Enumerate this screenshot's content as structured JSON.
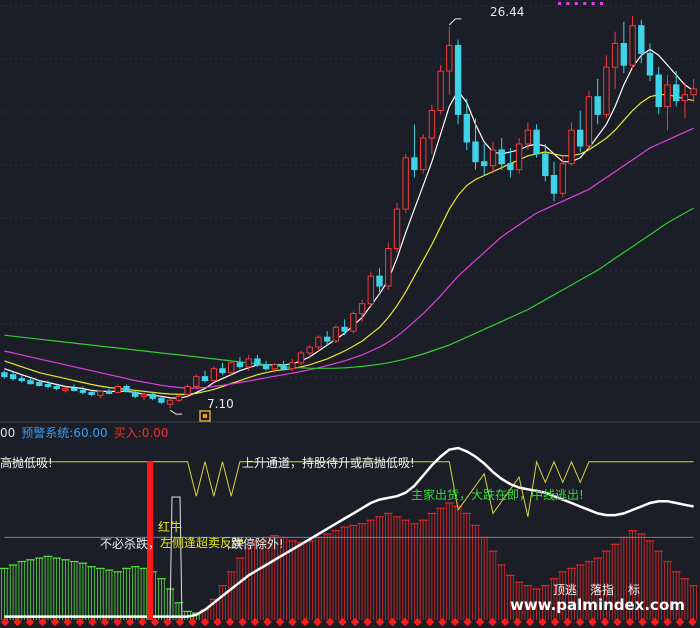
{
  "colors": {
    "background": "#1b1e26",
    "grid": "#2b303c",
    "up": "#f03a3a",
    "down": "#3fd3e8",
    "ma_white": "#ffffff",
    "ma_yellow": "#e8e830",
    "ma_magenta": "#e040e0",
    "ma_green": "#33cc33",
    "pink_dot": "#e040e0",
    "warn_line": "#d4d440",
    "blue_line": "#3c8cd8",
    "green_hist": "#56e03c",
    "red_hist": "#e02424",
    "signal_bar": "#ff1a1a"
  },
  "readout": {
    "value_prefix": "00",
    "warn_label": "预警系统:",
    "warn_value": "60.00",
    "buy_label": "买入:",
    "buy_value": "0.00"
  },
  "annotations": {
    "high_label": "26.44",
    "low_label": "7.10",
    "text_top_left": "高抛低吸!",
    "text_up_channel": "上升通道，持股待升或高抛低吸!",
    "text_main_out": "主家出货，大跌在即，中线逃出!",
    "text_no_sell": "不必杀跌，",
    "text_overlap": "左侧逢超卖反弹",
    "text_limit_down": ",跌停除外!",
    "text_red_cow": "红牛",
    "text_top_escape": "顶逃",
    "text_drop_index": "落指",
    "text_mark": "标",
    "watermark": "www.palmindex.com"
  },
  "chart_data": {
    "type": "candlestick",
    "price": {
      "candles": [
        [
          8.9,
          9.0,
          8.6,
          8.7
        ],
        [
          8.8,
          8.9,
          8.5,
          8.6
        ],
        [
          8.6,
          8.8,
          8.4,
          8.5
        ],
        [
          8.5,
          8.6,
          8.3,
          8.35
        ],
        [
          8.4,
          8.5,
          8.2,
          8.25
        ],
        [
          8.3,
          8.5,
          8.1,
          8.2
        ],
        [
          8.2,
          8.3,
          8.0,
          8.1
        ],
        [
          8.0,
          8.2,
          7.9,
          8.1
        ],
        [
          8.1,
          8.3,
          7.95,
          8.0
        ],
        [
          8.0,
          8.2,
          7.8,
          7.9
        ],
        [
          7.9,
          8.0,
          7.7,
          7.8
        ],
        [
          7.75,
          8.0,
          7.6,
          7.95
        ],
        [
          7.95,
          8.1,
          7.8,
          7.85
        ],
        [
          7.9,
          8.3,
          7.85,
          8.2
        ],
        [
          8.2,
          8.3,
          7.9,
          7.95
        ],
        [
          7.9,
          8.0,
          7.6,
          7.7
        ],
        [
          7.7,
          7.9,
          7.5,
          7.8
        ],
        [
          7.8,
          7.9,
          7.5,
          7.6
        ],
        [
          7.6,
          7.7,
          7.3,
          7.4
        ],
        [
          7.3,
          7.6,
          7.1,
          7.5
        ],
        [
          7.5,
          7.8,
          7.4,
          7.7
        ],
        [
          7.8,
          8.3,
          7.7,
          8.2
        ],
        [
          8.2,
          8.8,
          8.1,
          8.7
        ],
        [
          8.7,
          9.0,
          8.4,
          8.5
        ],
        [
          8.5,
          9.2,
          8.5,
          9.1
        ],
        [
          9.1,
          9.4,
          8.8,
          8.9
        ],
        [
          8.9,
          9.5,
          8.8,
          9.4
        ],
        [
          9.4,
          9.7,
          9.1,
          9.2
        ],
        [
          9.2,
          9.8,
          9.0,
          9.6
        ],
        [
          9.6,
          9.8,
          9.2,
          9.3
        ],
        [
          9.3,
          9.5,
          9.0,
          9.1
        ],
        [
          9.1,
          9.4,
          8.9,
          9.3
        ],
        [
          9.3,
          9.5,
          9.0,
          9.1
        ],
        [
          9.1,
          9.6,
          9.0,
          9.4
        ],
        [
          9.4,
          10.0,
          9.3,
          9.9
        ],
        [
          9.9,
          10.3,
          9.6,
          10.2
        ],
        [
          10.2,
          10.8,
          10.0,
          10.7
        ],
        [
          10.7,
          11.0,
          10.3,
          10.5
        ],
        [
          10.5,
          11.3,
          10.4,
          11.2
        ],
        [
          11.2,
          11.6,
          10.8,
          11.0
        ],
        [
          11.0,
          12.0,
          10.9,
          11.9
        ],
        [
          11.9,
          12.6,
          11.5,
          12.4
        ],
        [
          12.4,
          14.0,
          12.2,
          13.8
        ],
        [
          13.8,
          14.2,
          13.0,
          13.3
        ],
        [
          13.3,
          15.5,
          13.1,
          15.2
        ],
        [
          15.2,
          17.5,
          15.0,
          17.2
        ],
        [
          17.2,
          20.0,
          17.0,
          19.8
        ],
        [
          19.8,
          21.5,
          18.8,
          19.2
        ],
        [
          19.2,
          21.0,
          19.0,
          20.8
        ],
        [
          20.8,
          22.5,
          20.0,
          22.2
        ],
        [
          22.2,
          24.5,
          22.0,
          24.2
        ],
        [
          24.2,
          26.44,
          23.0,
          25.5
        ],
        [
          25.5,
          25.8,
          21.5,
          22.0
        ],
        [
          22.0,
          22.8,
          20.2,
          20.6
        ],
        [
          20.6,
          21.8,
          19.2,
          19.6
        ],
        [
          19.6,
          20.5,
          18.9,
          19.4
        ],
        [
          19.4,
          20.6,
          19.0,
          20.2
        ],
        [
          20.2,
          20.8,
          19.2,
          19.5
        ],
        [
          19.5,
          20.3,
          18.8,
          19.2
        ],
        [
          19.2,
          20.8,
          19.0,
          20.5
        ],
        [
          20.5,
          21.6,
          20.2,
          21.2
        ],
        [
          21.2,
          21.5,
          19.8,
          20.0
        ],
        [
          20.0,
          20.5,
          18.6,
          18.9
        ],
        [
          18.9,
          19.6,
          17.6,
          18.0
        ],
        [
          18.0,
          19.9,
          17.8,
          19.5
        ],
        [
          19.5,
          21.6,
          19.4,
          21.2
        ],
        [
          21.2,
          22.2,
          20.1,
          20.4
        ],
        [
          20.4,
          23.2,
          20.2,
          22.9
        ],
        [
          22.9,
          23.8,
          21.5,
          22.0
        ],
        [
          22.0,
          25.0,
          21.8,
          24.4
        ],
        [
          24.4,
          26.2,
          23.3,
          25.6
        ],
        [
          25.6,
          26.7,
          24.1,
          24.5
        ],
        [
          24.5,
          27.0,
          24.3,
          26.5
        ],
        [
          26.5,
          26.8,
          24.6,
          25.1
        ],
        [
          25.1,
          25.6,
          23.7,
          24.0
        ],
        [
          24.0,
          24.4,
          22.0,
          22.4
        ],
        [
          22.4,
          24.0,
          21.2,
          23.5
        ],
        [
          23.5,
          24.2,
          22.4,
          22.7
        ],
        [
          22.7,
          23.6,
          21.8,
          23.0
        ],
        [
          23.0,
          23.8,
          22.6,
          23.3
        ]
      ],
      "ma": [
        {
          "color": "white",
          "values": [
            9.1,
            8.95,
            8.8,
            8.65,
            8.5,
            8.4,
            8.3,
            8.2,
            8.15,
            8.1,
            8.0,
            7.95,
            7.95,
            7.95,
            7.95,
            7.9,
            7.8,
            7.75,
            7.7,
            7.62,
            7.6,
            7.7,
            7.9,
            8.1,
            8.4,
            8.6,
            8.8,
            9.0,
            9.15,
            9.3,
            9.3,
            9.3,
            9.3,
            9.35,
            9.5,
            9.7,
            10.0,
            10.3,
            10.6,
            10.9,
            11.3,
            11.7,
            12.3,
            12.9,
            13.6,
            14.7,
            16.0,
            17.2,
            18.4,
            19.6,
            21.0,
            22.4,
            23.2,
            22.6,
            21.5,
            20.6,
            20.1,
            20.0,
            20.1,
            20.2,
            20.4,
            20.5,
            20.4,
            20.0,
            19.6,
            19.6,
            19.8,
            20.3,
            20.9,
            21.5,
            22.4,
            23.5,
            24.4,
            25.0,
            25.3,
            25.0,
            24.5,
            24.0,
            23.5,
            23.2
          ]
        },
        {
          "color": "yellow",
          "values": [
            9.5,
            9.35,
            9.2,
            9.05,
            8.9,
            8.8,
            8.7,
            8.6,
            8.5,
            8.4,
            8.3,
            8.22,
            8.15,
            8.1,
            8.05,
            8.0,
            7.95,
            7.9,
            7.85,
            7.82,
            7.8,
            7.8,
            7.85,
            7.95,
            8.05,
            8.2,
            8.35,
            8.5,
            8.65,
            8.8,
            8.9,
            9.0,
            9.05,
            9.1,
            9.2,
            9.3,
            9.45,
            9.6,
            9.8,
            10.0,
            10.25,
            10.5,
            10.85,
            11.2,
            11.7,
            12.3,
            13.0,
            13.8,
            14.6,
            15.4,
            16.3,
            17.2,
            17.9,
            18.4,
            18.7,
            18.9,
            19.1,
            19.3,
            19.5,
            19.7,
            19.9,
            20.0,
            20.1,
            20.0,
            19.9,
            19.9,
            20.0,
            20.2,
            20.5,
            20.8,
            21.2,
            21.7,
            22.2,
            22.6,
            22.9,
            23.0,
            23.0,
            22.9,
            22.8,
            22.7
          ]
        },
        {
          "color": "magenta",
          "values": [
            10.0,
            9.9,
            9.8,
            9.7,
            9.6,
            9.5,
            9.4,
            9.3,
            9.2,
            9.1,
            9.0,
            8.9,
            8.8,
            8.7,
            8.6,
            8.5,
            8.42,
            8.34,
            8.26,
            8.2,
            8.15,
            8.12,
            8.12,
            8.15,
            8.2,
            8.26,
            8.33,
            8.4,
            8.48,
            8.56,
            8.64,
            8.72,
            8.8,
            8.88,
            8.96,
            9.05,
            9.15,
            9.26,
            9.38,
            9.5,
            9.65,
            9.8,
            10.0,
            10.2,
            10.45,
            10.75,
            11.1,
            11.5,
            11.9,
            12.35,
            12.8,
            13.3,
            13.8,
            14.2,
            14.6,
            15.0,
            15.4,
            15.8,
            16.1,
            16.4,
            16.7,
            17.0,
            17.2,
            17.4,
            17.6,
            17.8,
            18.0,
            18.2,
            18.5,
            18.8,
            19.1,
            19.4,
            19.7,
            20.0,
            20.3,
            20.5,
            20.7,
            20.9,
            21.1,
            21.3
          ]
        },
        {
          "color": "green",
          "values": [
            10.8,
            10.75,
            10.7,
            10.65,
            10.6,
            10.55,
            10.5,
            10.45,
            10.4,
            10.35,
            10.3,
            10.25,
            10.2,
            10.15,
            10.1,
            10.05,
            10.0,
            9.95,
            9.9,
            9.85,
            9.8,
            9.75,
            9.7,
            9.65,
            9.6,
            9.55,
            9.5,
            9.45,
            9.4,
            9.35,
            9.3,
            9.25,
            9.2,
            9.17,
            9.15,
            9.13,
            9.12,
            9.12,
            9.13,
            9.15,
            9.18,
            9.22,
            9.27,
            9.33,
            9.4,
            9.5,
            9.6,
            9.72,
            9.85,
            10.0,
            10.15,
            10.3,
            10.5,
            10.7,
            10.9,
            11.1,
            11.3,
            11.5,
            11.7,
            11.9,
            12.1,
            12.35,
            12.6,
            12.85,
            13.1,
            13.35,
            13.6,
            13.85,
            14.1,
            14.4,
            14.7,
            15.0,
            15.3,
            15.6,
            15.9,
            16.2,
            16.5,
            16.75,
            17.0,
            17.25
          ]
        }
      ],
      "high": {
        "value": 26.44,
        "index": 51
      },
      "low": {
        "value": 7.1,
        "index": 19
      },
      "ylim": [
        6.5,
        27.5
      ]
    },
    "indicator": {
      "ylim": [
        0,
        100
      ],
      "white_line": [
        2,
        2,
        2,
        2,
        2,
        2,
        2,
        2,
        2,
        2,
        2,
        2,
        2,
        2,
        2,
        2,
        2,
        2,
        2,
        2,
        2,
        2,
        3,
        6,
        10,
        14,
        18,
        22,
        26,
        29,
        32,
        35,
        38,
        41,
        44,
        47,
        50,
        53,
        56,
        59,
        62,
        65,
        68,
        70,
        71,
        72,
        74,
        78,
        84,
        90,
        95,
        99,
        100,
        98,
        95,
        91,
        86,
        82,
        79,
        77,
        76,
        75,
        74,
        72,
        70,
        68,
        66,
        64,
        62,
        61,
        61,
        62,
        64,
        66,
        68,
        69,
        69,
        68,
        67,
        66
      ],
      "yellow_line": [
        92,
        92,
        92,
        92,
        92,
        92,
        92,
        92,
        92,
        92,
        92,
        92,
        92,
        92,
        92,
        92,
        92,
        92,
        92,
        92,
        92,
        92,
        92,
        92,
        92,
        92,
        92,
        92,
        92,
        92,
        92,
        92,
        92,
        92,
        92,
        92,
        92,
        92,
        92,
        92,
        92,
        92,
        92,
        92,
        92,
        92,
        92,
        92,
        92,
        92,
        92,
        92,
        92,
        92,
        92,
        92,
        92,
        92,
        92,
        92,
        92,
        92,
        92,
        92,
        92,
        92,
        92,
        92,
        92,
        92,
        92,
        92,
        92,
        92,
        92,
        92,
        92,
        92,
        92,
        92
      ],
      "blue_line": [
        48,
        48,
        48,
        48,
        48,
        48,
        48,
        48,
        48,
        48,
        48,
        48,
        48,
        48,
        48,
        48,
        48,
        48,
        48,
        48,
        48,
        48,
        48,
        48,
        48,
        48,
        48,
        48,
        48,
        48,
        48,
        48,
        48,
        48,
        48,
        48,
        48,
        48,
        48,
        48,
        48,
        48,
        48,
        48,
        48,
        48,
        48,
        48,
        48,
        48,
        48,
        48,
        48,
        48,
        48,
        48,
        48,
        48,
        48,
        48,
        48,
        48,
        48,
        48,
        48,
        48,
        48,
        48,
        48,
        48,
        48,
        48,
        48,
        48,
        48,
        48,
        48,
        48,
        48,
        48
      ],
      "bars": [
        30,
        32,
        34,
        35,
        36,
        37,
        36,
        35,
        34,
        33,
        31,
        30,
        29,
        28,
        30,
        31,
        30,
        28,
        24,
        18,
        10,
        5,
        4,
        6,
        12,
        20,
        28,
        36,
        42,
        46,
        48,
        49,
        48,
        46,
        45,
        46,
        48,
        50,
        52,
        54,
        55,
        56,
        58,
        60,
        62,
        60,
        58,
        56,
        58,
        62,
        65,
        68,
        66,
        62,
        55,
        48,
        40,
        32,
        26,
        22,
        20,
        18,
        20,
        24,
        28,
        30,
        32,
        34,
        36,
        40,
        44,
        48,
        52,
        50,
        46,
        40,
        34,
        28,
        24,
        20
      ],
      "bar_colors": [
        "green",
        "green",
        "green",
        "green",
        "green",
        "green",
        "green",
        "green",
        "green",
        "green",
        "green",
        "green",
        "green",
        "green",
        "green",
        "green",
        "green",
        "green",
        "green",
        "green",
        "green",
        "green",
        "green",
        "red",
        "red",
        "red",
        "red",
        "red",
        "red",
        "red",
        "red",
        "red",
        "red",
        "red",
        "red",
        "red",
        "red",
        "red",
        "red",
        "red",
        "red",
        "red",
        "red",
        "red",
        "red",
        "red",
        "red",
        "red",
        "red",
        "red",
        "red",
        "red",
        "red",
        "red",
        "red",
        "red",
        "red",
        "red",
        "red",
        "red",
        "red",
        "red",
        "red",
        "red",
        "red",
        "red",
        "red",
        "red",
        "red",
        "red",
        "red",
        "red",
        "red",
        "red",
        "red",
        "red",
        "red",
        "red",
        "red",
        "red"
      ]
    }
  }
}
